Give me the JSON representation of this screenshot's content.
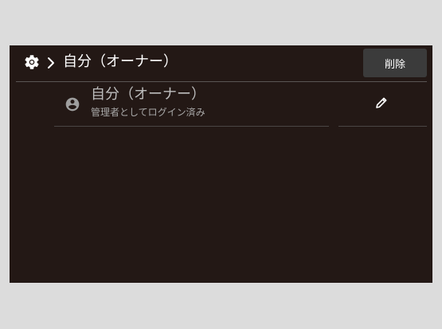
{
  "header": {
    "title": "自分（オーナー）",
    "delete_label": "削除",
    "icons": [
      "gear-icon",
      "chevron-right-icon"
    ]
  },
  "user": {
    "name": "自分（オーナー）",
    "role": "管理者としてログイン済み",
    "icons": [
      "account-circle-icon",
      "pencil-icon"
    ]
  },
  "colors": {
    "background": "#231815",
    "button": "#3b3b3b",
    "text_primary": "#ffffff",
    "text_secondary": "#bdbdbd"
  }
}
